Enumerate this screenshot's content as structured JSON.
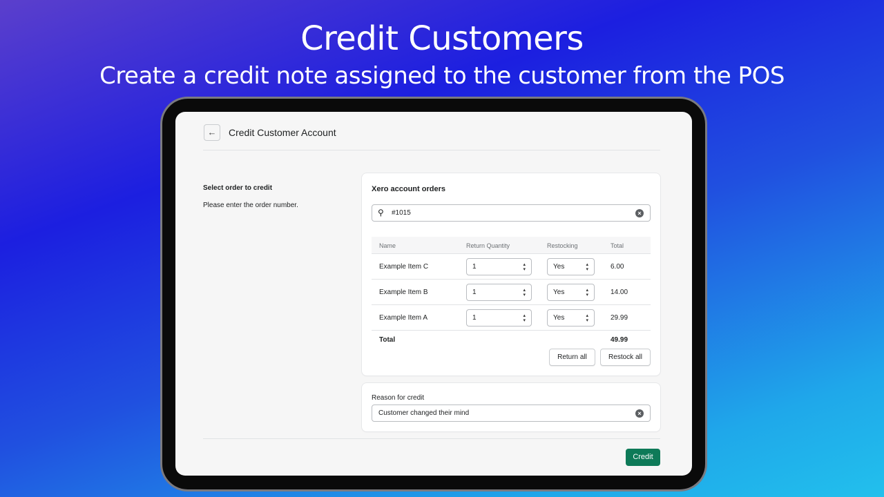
{
  "banner": {
    "title": "Credit Customers",
    "subtitle": "Create a credit note assigned to the customer from the POS"
  },
  "header": {
    "title": "Credit Customer Account",
    "back_icon": "arrow-left-icon"
  },
  "left": {
    "heading": "Select order to credit",
    "help": "Please enter the order number."
  },
  "orders": {
    "title": "Xero account orders",
    "search_value": "#1015",
    "columns": [
      "Name",
      "Return Quantity",
      "Restocking",
      "Total"
    ],
    "rows": [
      {
        "name": "Example Item C",
        "qty": "1",
        "restock": "Yes",
        "total": "6.00"
      },
      {
        "name": "Example Item B",
        "qty": "1",
        "restock": "Yes",
        "total": "14.00"
      },
      {
        "name": "Example Item A",
        "qty": "1",
        "restock": "Yes",
        "total": "29.99"
      }
    ],
    "total_label": "Total",
    "total_value": "49.99",
    "return_all": "Return all",
    "restock_all": "Restock all"
  },
  "reason": {
    "label": "Reason for credit",
    "value": "Customer changed their mind"
  },
  "credit_button": "Credit",
  "colors": {
    "primary": "#0e7a58"
  }
}
